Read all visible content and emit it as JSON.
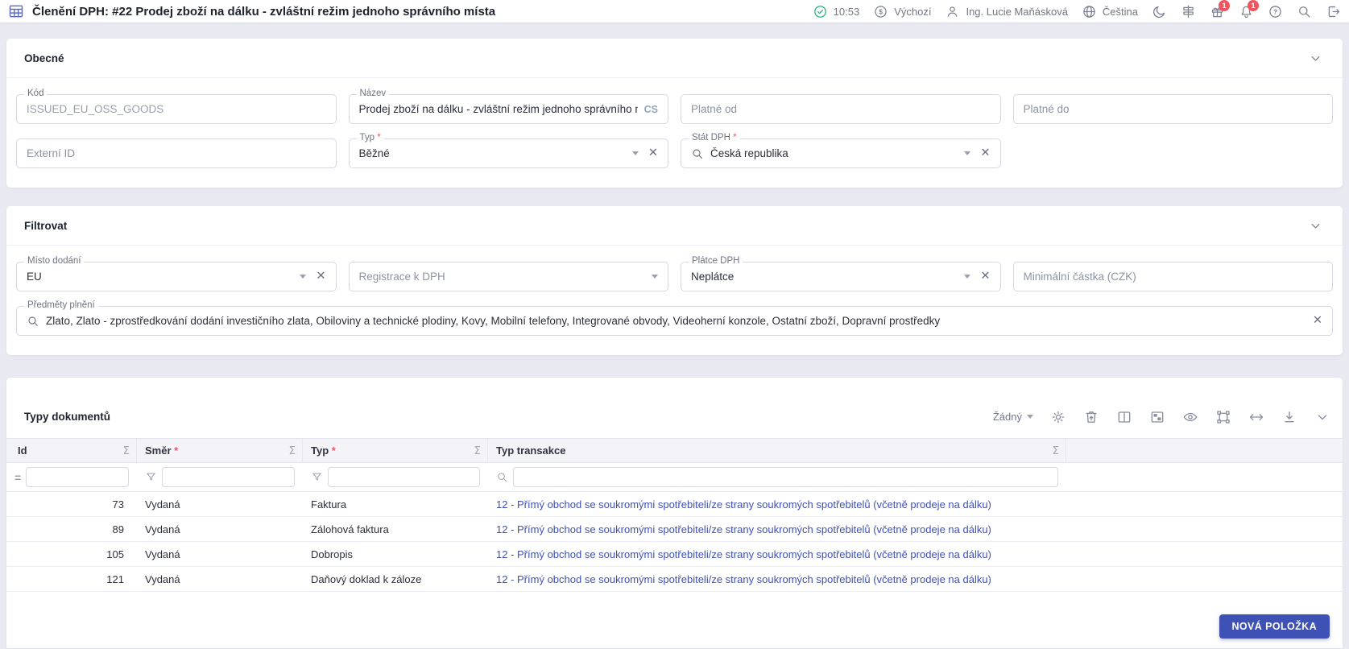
{
  "topbar": {
    "title": "Členění DPH: #22 Prodej zboží na dálku - zvláštní režim jednoho správního místa",
    "time": "10:53",
    "currency_profile": "Výchozí",
    "user_name": "Ing. Lucie Maňásková",
    "language": "Čeština",
    "gift_badge": "1",
    "notification_badge": "1"
  },
  "icons": {
    "sigma": "Σ",
    "equals": "=",
    "clear": "✕",
    "required": "*",
    "dollar": "$",
    "question": "?"
  },
  "general": {
    "title": "Obecné",
    "fields": {
      "kod": {
        "label": "Kód",
        "value": "ISSUED_EU_OSS_GOODS"
      },
      "nazev": {
        "label": "Název",
        "value": "Prodej zboží na dálku - zvláštní režim jednoho správního m",
        "lang_suffix": "CS"
      },
      "platne_od": {
        "label": "Platné od",
        "value": ""
      },
      "platne_do": {
        "label": "Platné do",
        "value": ""
      },
      "externi_id": {
        "label": "Externí ID",
        "value": ""
      },
      "typ": {
        "label": "Typ",
        "value": "Běžné"
      },
      "stat_dph": {
        "label": "Stát DPH",
        "value": "Česká republika"
      }
    }
  },
  "filter": {
    "title": "Filtrovat",
    "fields": {
      "misto_dodani": {
        "label": "Místo dodání",
        "value": "EU"
      },
      "registrace_k_dph": {
        "label": "Registrace k DPH",
        "value": ""
      },
      "platce_dph": {
        "label": "Plátce DPH",
        "value": "Neplátce"
      },
      "minimalni_castka": {
        "label": "Minimální částka (CZK)",
        "value": ""
      },
      "predmety_plneni": {
        "label": "Předměty plnění",
        "value": "Zlato, Zlato - zprostředkování dodání investičního zlata, Obiloviny a technické plodiny, Kovy, Mobilní telefony, Integrované obvody, Videoherní konzole, Ostatní zboží, Dopravní prostředky"
      }
    }
  },
  "documents": {
    "title": "Typy dokumentů",
    "toolbar": {
      "group_by": "Žádný"
    },
    "columns": [
      {
        "label": "Id",
        "required": false
      },
      {
        "label": "Směr",
        "required": true
      },
      {
        "label": "Typ",
        "required": true
      },
      {
        "label": "Typ transakce",
        "required": false
      }
    ],
    "rows": [
      {
        "id": "73",
        "smer": "Vydaná",
        "typ": "Faktura",
        "typ_transakce": "12 - Přímý obchod se soukromými spotřebiteli/ze strany soukromých spotřebitelů (včetně prodeje na dálku)"
      },
      {
        "id": "89",
        "smer": "Vydaná",
        "typ": "Zálohová faktura",
        "typ_transakce": "12 - Přímý obchod se soukromými spotřebiteli/ze strany soukromých spotřebitelů (včetně prodeje na dálku)"
      },
      {
        "id": "105",
        "smer": "Vydaná",
        "typ": "Dobropis",
        "typ_transakce": "12 - Přímý obchod se soukromými spotřebiteli/ze strany soukromých spotřebitelů (včetně prodeje na dálku)"
      },
      {
        "id": "121",
        "smer": "Vydaná",
        "typ": "Daňový doklad k záloze",
        "typ_transakce": "12 - Přímý obchod se soukromými spotřebiteli/ze strany soukromých spotřebitelů (včetně prodeje na dálku)"
      }
    ],
    "new_item_button": "NOVÁ POLOŽKA"
  },
  "colors": {
    "primary": "#3f51b5",
    "link": "#3f51b5",
    "badge_red": "#f2545f",
    "success_green": "#26b47c",
    "required_red": "#f4516c",
    "page_background": "#e9e9f1"
  }
}
